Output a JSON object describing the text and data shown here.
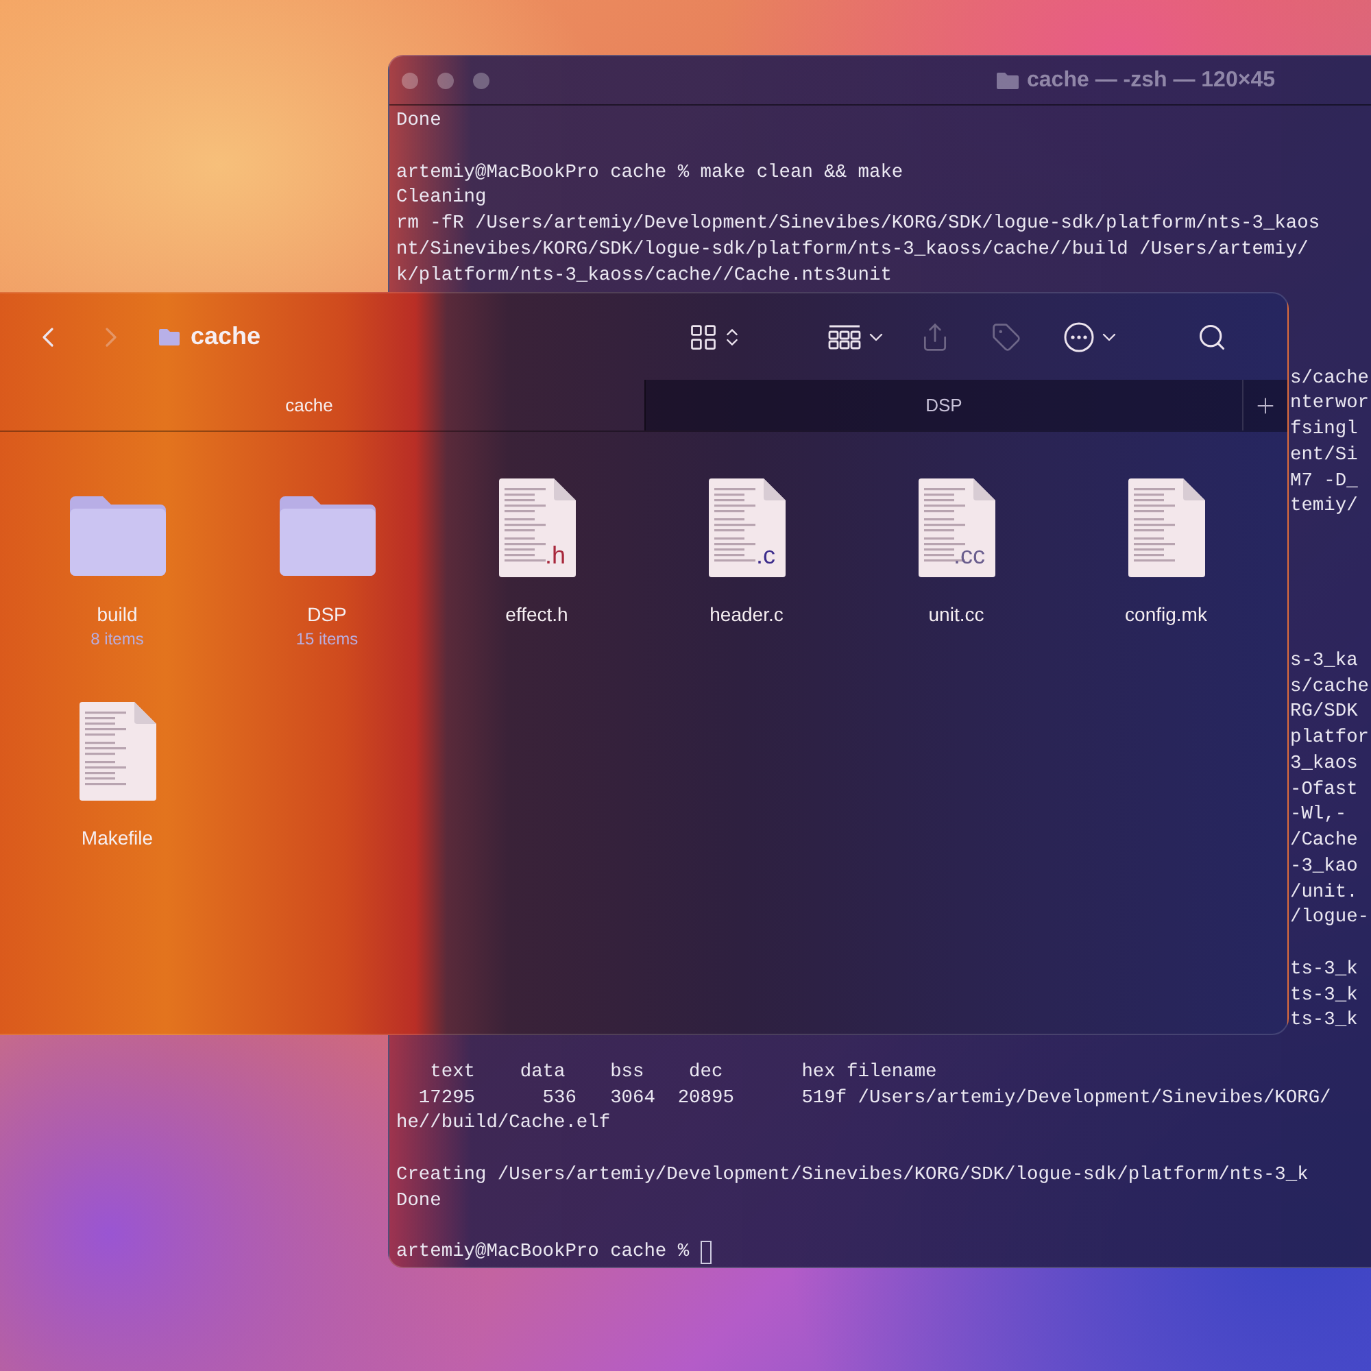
{
  "terminal": {
    "title": "cache — -zsh — 120×45",
    "lines": [
      {
        "kind": "full",
        "text": "Done"
      },
      {
        "kind": "blank"
      },
      {
        "kind": "full",
        "text": "artemiy@MacBookPro cache % make clean && make"
      },
      {
        "kind": "full",
        "text": "Cleaning"
      },
      {
        "kind": "full",
        "text": "rm -fR /Users/artemiy/Development/Sinevibes/KORG/SDK/logue-sdk/platform/nts-3_kaos"
      },
      {
        "kind": "full",
        "text": "nt/Sinevibes/KORG/SDK/logue-sdk/platform/nts-3_kaoss/cache//build /Users/artemiy/"
      },
      {
        "kind": "full",
        "text": "k/platform/nts-3_kaoss/cache//Cache.nts3unit"
      },
      {
        "kind": "blank"
      },
      {
        "kind": "blank"
      },
      {
        "kind": "blank"
      },
      {
        "kind": "tail",
        "text": "s/cache"
      },
      {
        "kind": "tail",
        "text": "nterwor"
      },
      {
        "kind": "tail",
        "text": "fsingl"
      },
      {
        "kind": "tail",
        "text": "ent/Si"
      },
      {
        "kind": "tail",
        "text": "M7 -D_"
      },
      {
        "kind": "tail",
        "text": "temiy/"
      },
      {
        "kind": "blank"
      },
      {
        "kind": "blank"
      },
      {
        "kind": "blank"
      },
      {
        "kind": "blank"
      },
      {
        "kind": "blank"
      },
      {
        "kind": "tail",
        "text": "s-3_ka"
      },
      {
        "kind": "tail",
        "text": "s/cache"
      },
      {
        "kind": "tail",
        "text": "RG/SDK"
      },
      {
        "kind": "tail",
        "text": "platfor"
      },
      {
        "kind": "tail",
        "text": "3_kaos"
      },
      {
        "kind": "tail",
        "text": "-Ofast"
      },
      {
        "kind": "tail",
        "text": "-Wl,-"
      },
      {
        "kind": "tail",
        "text": "/Cache"
      },
      {
        "kind": "tail",
        "text": "-3_kao"
      },
      {
        "kind": "tail",
        "text": "/unit."
      },
      {
        "kind": "tail",
        "text": "/logue-"
      },
      {
        "kind": "blank"
      },
      {
        "kind": "tail",
        "text": "ts-3_k"
      },
      {
        "kind": "tail",
        "text": "ts-3_k"
      },
      {
        "kind": "tail",
        "text": "ts-3_k"
      },
      {
        "kind": "blank"
      },
      {
        "kind": "full",
        "text": "   text    data    bss    dec       hex filename"
      },
      {
        "kind": "full",
        "text": "  17295      536   3064  20895      519f /Users/artemiy/Development/Sinevibes/KORG/"
      },
      {
        "kind": "full",
        "text": "he//build/Cache.elf"
      },
      {
        "kind": "blank"
      },
      {
        "kind": "full",
        "text": "Creating /Users/artemiy/Development/Sinevibes/KORG/SDK/logue-sdk/platform/nts-3_k"
      },
      {
        "kind": "full",
        "text": "Done"
      },
      {
        "kind": "blank"
      },
      {
        "kind": "prompt",
        "text": "artemiy@MacBookPro cache % "
      }
    ]
  },
  "finder": {
    "title": "cache",
    "toolbar_buttons": [
      {
        "kind": "back",
        "disabled": false
      },
      {
        "kind": "forward",
        "disabled": true
      },
      {
        "kind": "view",
        "disabled": false
      },
      {
        "kind": "group",
        "disabled": false
      },
      {
        "kind": "share",
        "disabled": true
      },
      {
        "kind": "tag",
        "disabled": true
      },
      {
        "kind": "more",
        "disabled": false
      },
      {
        "kind": "search",
        "disabled": false
      }
    ],
    "tabs": [
      {
        "label": "cache",
        "selected": true
      },
      {
        "label": "DSP",
        "selected": false
      }
    ],
    "items": [
      {
        "kind": "folder",
        "name": "build",
        "count": "8 items"
      },
      {
        "kind": "folder",
        "name": "DSP",
        "count": "15 items"
      },
      {
        "kind": "document",
        "name": "effect.h",
        "badge": ".h",
        "color": "#a8283c"
      },
      {
        "kind": "document",
        "name": "header.c",
        "badge": ".c",
        "color": "#3c2c8c"
      },
      {
        "kind": "document",
        "name": "unit.cc",
        "badge": ".cc",
        "color": "#6a5e8e"
      },
      {
        "kind": "document",
        "name": "config.mk"
      },
      {
        "kind": "document",
        "name": "Makefile"
      }
    ]
  }
}
